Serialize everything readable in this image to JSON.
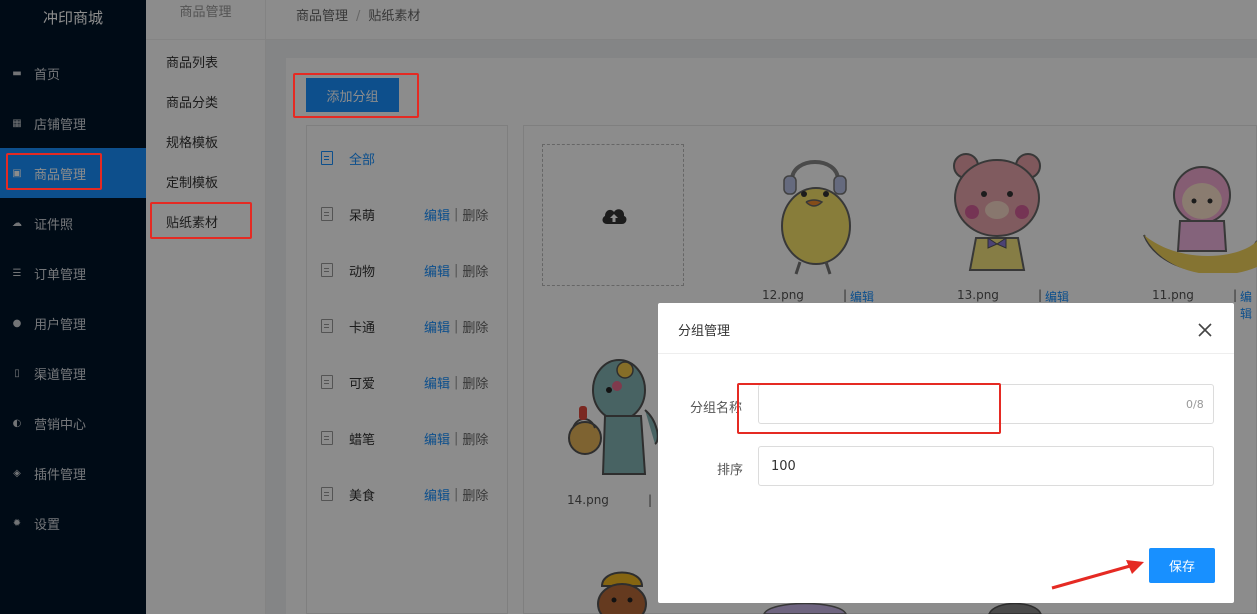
{
  "app": {
    "title": "冲印商城"
  },
  "sidebar": {
    "items": [
      {
        "label": "首页",
        "icon": "monitor-icon"
      },
      {
        "label": "店铺管理",
        "icon": "grid-icon"
      },
      {
        "label": "商品管理",
        "icon": "apps-icon",
        "active": true
      },
      {
        "label": "证件照",
        "icon": "cloud-icon"
      },
      {
        "label": "订单管理",
        "icon": "list-icon"
      },
      {
        "label": "用户管理",
        "icon": "user-icon"
      },
      {
        "label": "渠道管理",
        "icon": "mobile-icon"
      },
      {
        "label": "营销中心",
        "icon": "palette-icon"
      },
      {
        "label": "插件管理",
        "icon": "layers-icon"
      },
      {
        "label": "设置",
        "icon": "gear-icon"
      }
    ]
  },
  "subnav": {
    "title": "商品管理",
    "items": [
      {
        "label": "商品列表"
      },
      {
        "label": "商品分类"
      },
      {
        "label": "规格模板"
      },
      {
        "label": "定制模板"
      },
      {
        "label": "贴纸素材",
        "active": true
      }
    ]
  },
  "breadcrumb": {
    "parent": "商品管理",
    "sep": "/",
    "current": "贴纸素材"
  },
  "toolbar": {
    "add_group": "添加分组"
  },
  "groups": {
    "all_label": "全部",
    "edit": "编辑",
    "pipe": "|",
    "delete": "删除",
    "items": [
      {
        "name": "呆萌"
      },
      {
        "name": "动物"
      },
      {
        "name": "卡通"
      },
      {
        "name": "可爱"
      },
      {
        "name": "蜡笔"
      },
      {
        "name": "美食"
      }
    ]
  },
  "media": {
    "edit": "编辑",
    "pipe": "|",
    "files": [
      "12.png",
      "13.png",
      "11.png",
      "14.png"
    ]
  },
  "modal": {
    "title": "分组管理",
    "name_label": "分组名称",
    "name_value": "",
    "name_count": "0/8",
    "sort_label": "排序",
    "sort_value": "100",
    "save": "保存"
  },
  "colors": {
    "primary": "#1890ff",
    "sidebar_bg": "#001529",
    "annotation": "#e52a23"
  }
}
